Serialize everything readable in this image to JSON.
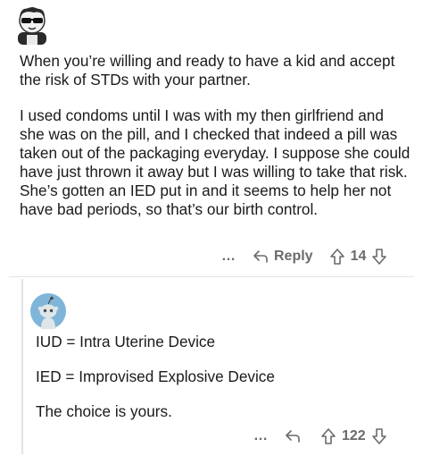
{
  "post": {
    "paragraphs": [
      "When you’re willing and ready to have a kid and accept the risk of STDs with your partner.",
      "I used condoms until I was with my then girlfriend and she was on the pill, and I checked that indeed a pill was taken out of the packaging everyday. I suppose she could have just thrown it away but I was willing to take that risk. She’s gotten an IED put in and it seems to help her not have bad periods, so that’s our birth control."
    ],
    "actions": {
      "more": "…",
      "reply_label": "Reply",
      "votes": "14"
    },
    "icons": {
      "avatar": "sunglasses-character-avatar-icon",
      "reply": "reply-arrow-icon",
      "upvote": "upvote-arrow-icon",
      "downvote": "downvote-arrow-icon"
    }
  },
  "reply_comment": {
    "lines": [
      "IUD = Intra Uterine Device",
      "IED = Improvised Explosive Device",
      "The choice is yours."
    ],
    "actions": {
      "more": "…",
      "votes": "122"
    },
    "icons": {
      "avatar": "snoo-avatar-icon",
      "reply": "reply-arrow-icon",
      "upvote": "upvote-arrow-icon",
      "downvote": "downvote-arrow-icon"
    }
  },
  "colors": {
    "text": "#1a1a1b",
    "meta": "#6a6a6d",
    "snoo_background": "#7fb5d8",
    "divider": "#e4e4e6"
  }
}
